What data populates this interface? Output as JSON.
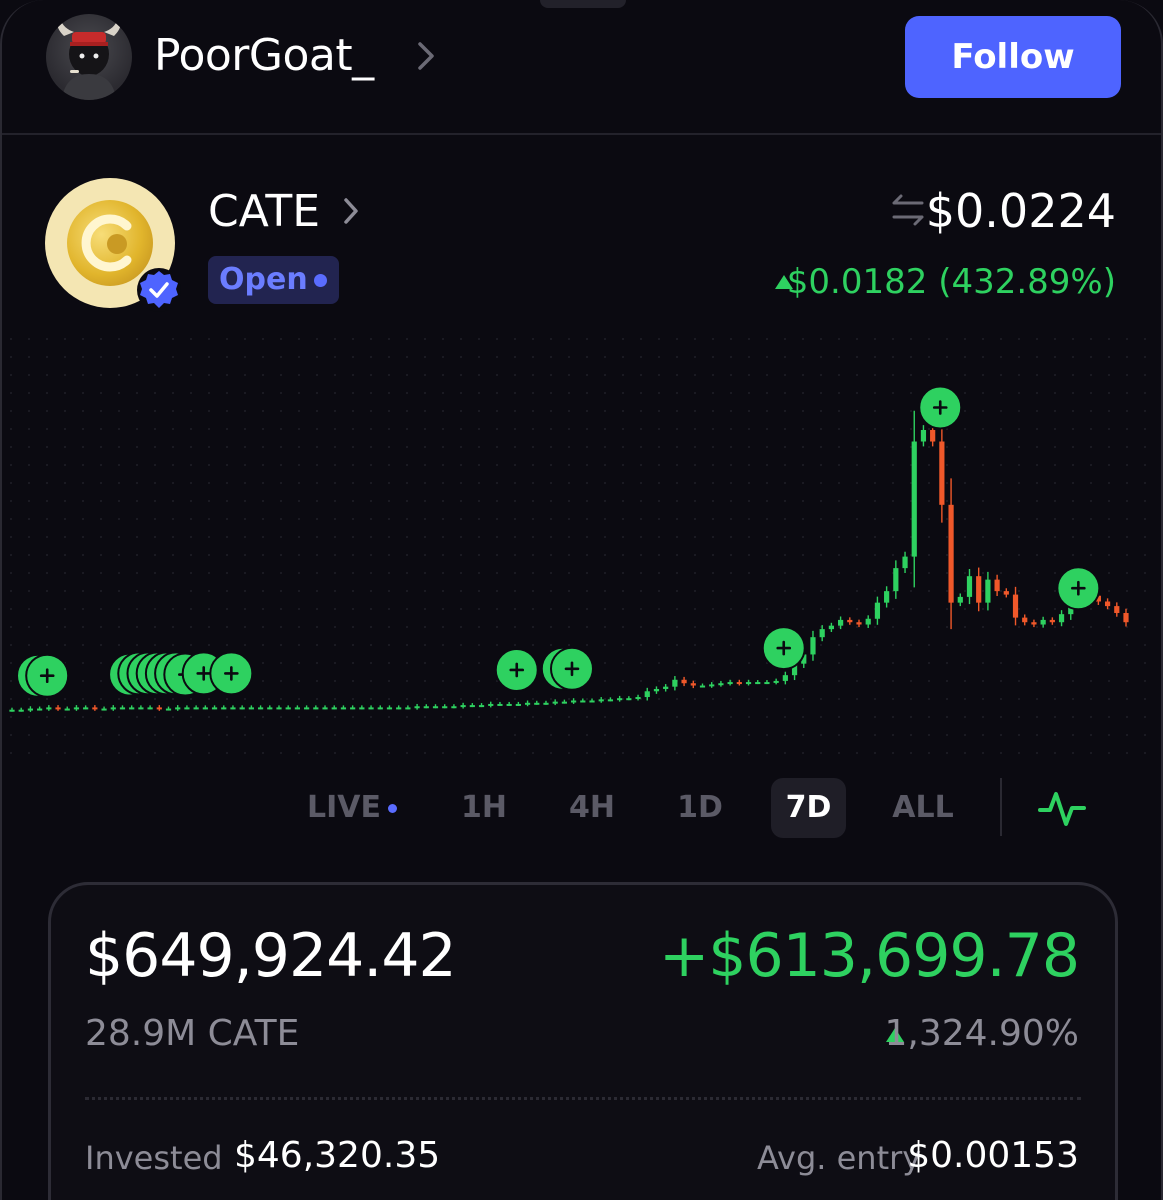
{
  "user": {
    "name": "PoorGoat_",
    "follow_label": "Follow"
  },
  "token": {
    "name": "CATE",
    "status": "Open",
    "price": "$0.0224",
    "change": "$0.0182 (432.89%)"
  },
  "colors": {
    "background": "#0b0a11",
    "accent": "#4e64ff",
    "up": "#2ed160",
    "down": "#f0582a",
    "muted": "#8d8c97"
  },
  "chart_data": {
    "type": "candlestick",
    "title": "",
    "xlabel": "",
    "ylabel": "",
    "grid": "dotted",
    "close": [
      0.0042,
      0.0042,
      0.0043,
      0.0043,
      0.0044,
      0.0043,
      0.0043,
      0.0044,
      0.0044,
      0.0043,
      0.0043,
      0.0044,
      0.0044,
      0.0044,
      0.0044,
      0.0044,
      0.0043,
      0.0043,
      0.0044,
      0.0044,
      0.0044,
      0.0044,
      0.0044,
      0.0044,
      0.0044,
      0.0044,
      0.0044,
      0.0044,
      0.0044,
      0.0044,
      0.0044,
      0.0044,
      0.0044,
      0.0044,
      0.0044,
      0.0044,
      0.0044,
      0.0044,
      0.0044,
      0.0044,
      0.0044,
      0.0044,
      0.0044,
      0.0044,
      0.0045,
      0.0045,
      0.0045,
      0.0045,
      0.0045,
      0.0046,
      0.0046,
      0.0046,
      0.0047,
      0.0047,
      0.0047,
      0.0047,
      0.0048,
      0.0048,
      0.0048,
      0.0049,
      0.0049,
      0.005,
      0.005,
      0.005,
      0.0051,
      0.0051,
      0.0052,
      0.0052,
      0.0053,
      0.0058,
      0.006,
      0.0062,
      0.0068,
      0.0065,
      0.0063,
      0.0063,
      0.0064,
      0.0065,
      0.0066,
      0.0065,
      0.0066,
      0.0066,
      0.0066,
      0.0067,
      0.0072,
      0.0082,
      0.009,
      0.0105,
      0.0112,
      0.0115,
      0.012,
      0.0118,
      0.0116,
      0.0121,
      0.0135,
      0.0145,
      0.0165,
      0.0175,
      0.0275,
      0.0285,
      0.0275,
      0.022,
      0.0135,
      0.014,
      0.0158,
      0.0135,
      0.0155,
      0.0145,
      0.0142,
      0.0122,
      0.0118,
      0.0116,
      0.012,
      0.0118,
      0.0125,
      0.0138,
      0.0148,
      0.0141,
      0.0136,
      0.0132,
      0.0126,
      0.0118
    ],
    "buy_markers": [
      0,
      1,
      10,
      11,
      12,
      13,
      14,
      15,
      16,
      18,
      21,
      52,
      57,
      58,
      81,
      98,
      113
    ],
    "price_range_shown": [
      0.004,
      0.0285
    ]
  },
  "timeframes": {
    "live": "LIVE",
    "h1": "1H",
    "h4": "4H",
    "d1": "1D",
    "d7": "7D",
    "all": "ALL",
    "active": "7D"
  },
  "position": {
    "value": "$649,924.42",
    "amount": "28.9M CATE",
    "pnl": "+$613,699.78",
    "pnl_pct": "1,324.90%",
    "invested_label": "Invested",
    "invested_value": "$46,320.35",
    "avg_entry_label": "Avg. entry",
    "avg_entry_value": "$0.00153"
  }
}
